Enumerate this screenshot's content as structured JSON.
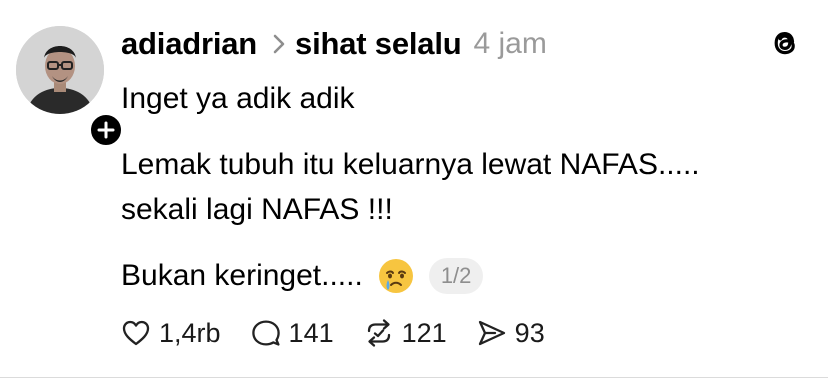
{
  "post": {
    "author": "adiadrian",
    "topic": "sihat selalu",
    "time": "4 jam",
    "lines": [
      "Inget ya adik adik",
      "Lemak tubuh itu keluarnya lewat NAFAS.....",
      "sekali lagi NAFAS !!!",
      "Bukan keringet....."
    ],
    "page_indicator": "1/2",
    "emoji": "face-holding-back-tears-icon"
  },
  "actions": {
    "likes": "1,4rb",
    "replies": "141",
    "reposts": "121",
    "shares": "93"
  },
  "colors": {
    "text": "#000000",
    "muted": "#9a9a9a",
    "badge_bg": "#efefef",
    "emoji_yellow": "#f7c540",
    "tear_blue": "#5aa9e6"
  }
}
